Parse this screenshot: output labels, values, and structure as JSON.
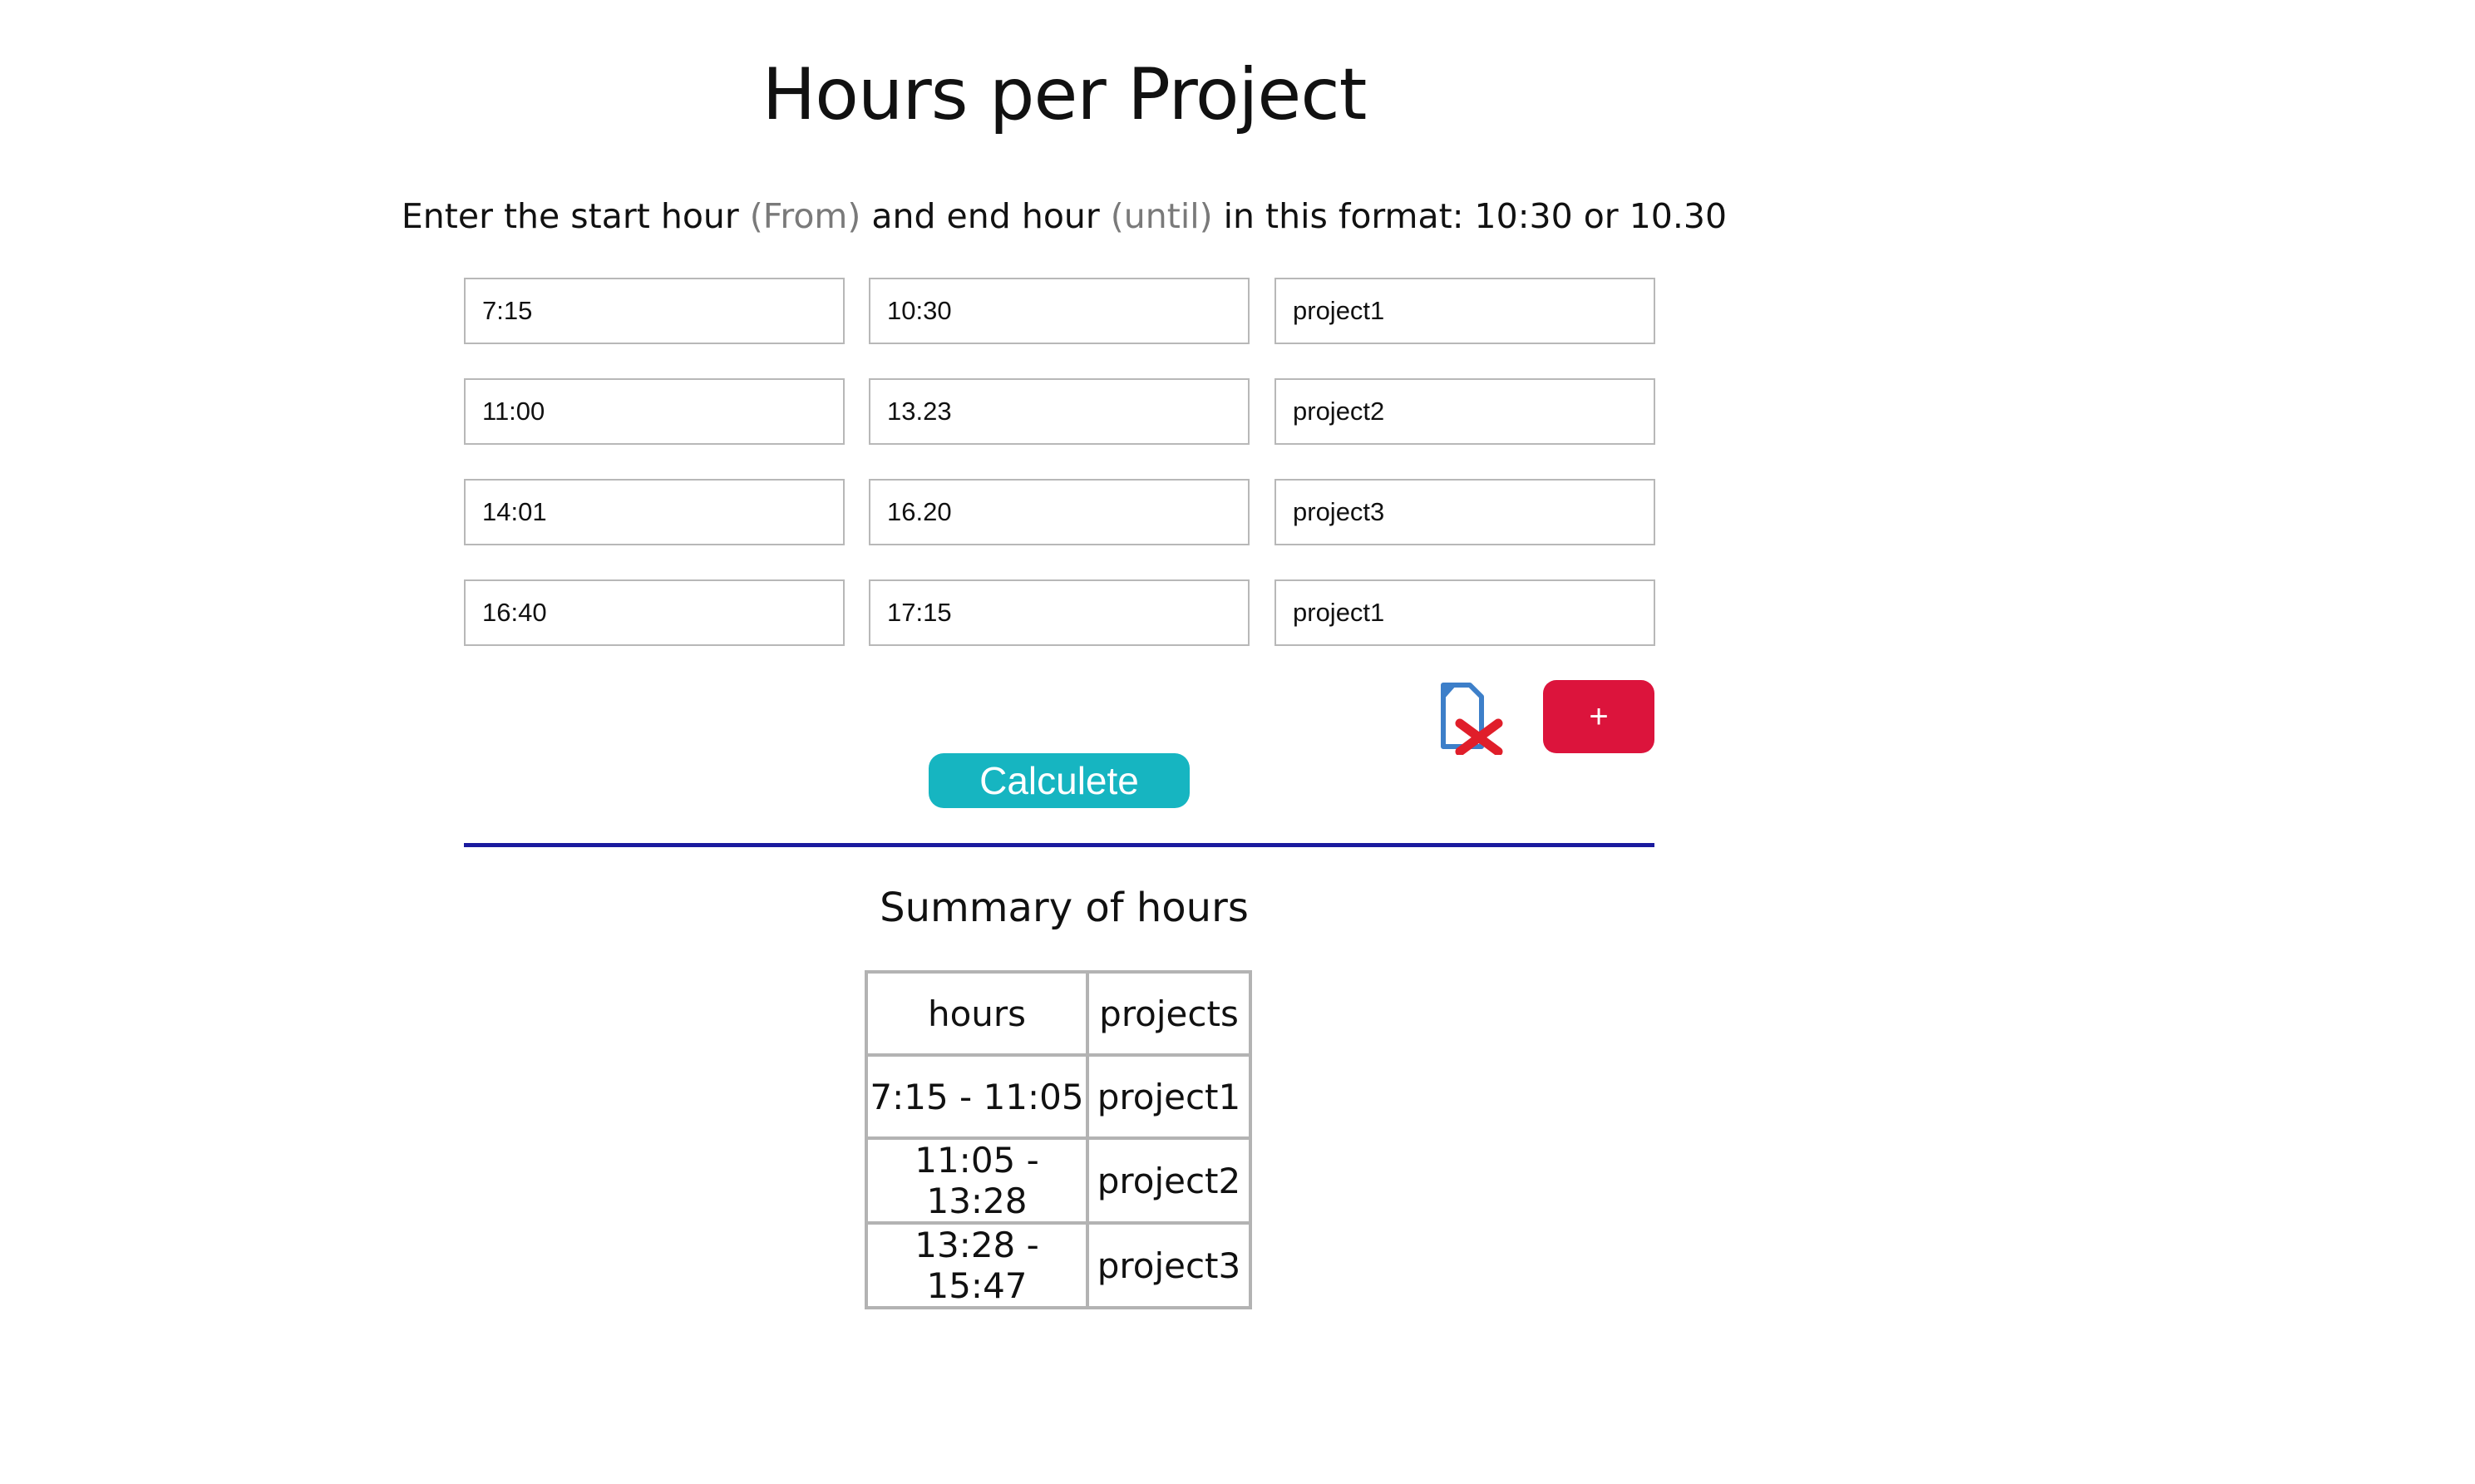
{
  "header": {
    "title": "Hours per Project"
  },
  "instructions": {
    "part1": "Enter the start hour ",
    "from": "(From)",
    "part2": " and end hour ",
    "until": "(until)",
    "part3": " in this format: 10:30 or 10.30"
  },
  "rows": [
    {
      "from": "7:15",
      "until": "10:30",
      "project": "project1"
    },
    {
      "from": "11:00",
      "until": "13.23",
      "project": "project2"
    },
    {
      "from": "14:01",
      "until": "16.20",
      "project": "project3"
    },
    {
      "from": "16:40",
      "until": "17:15",
      "project": "project1"
    }
  ],
  "actions": {
    "delete_icon": "delete-file-icon",
    "add_label": "+",
    "calculate_label": "Calculete"
  },
  "colors": {
    "add_button": "#dc143c",
    "calculate_button": "#16b5c1",
    "divider": "#1a1a9e"
  },
  "summary": {
    "title": "Summary of hours",
    "headers": [
      "hours",
      "projects"
    ],
    "rows": [
      {
        "hours": "7:15 - 11:05",
        "project": "project1"
      },
      {
        "hours": "11:05 - 13:28",
        "project": "project2"
      },
      {
        "hours": "13:28 - 15:47",
        "project": "project3"
      }
    ]
  }
}
